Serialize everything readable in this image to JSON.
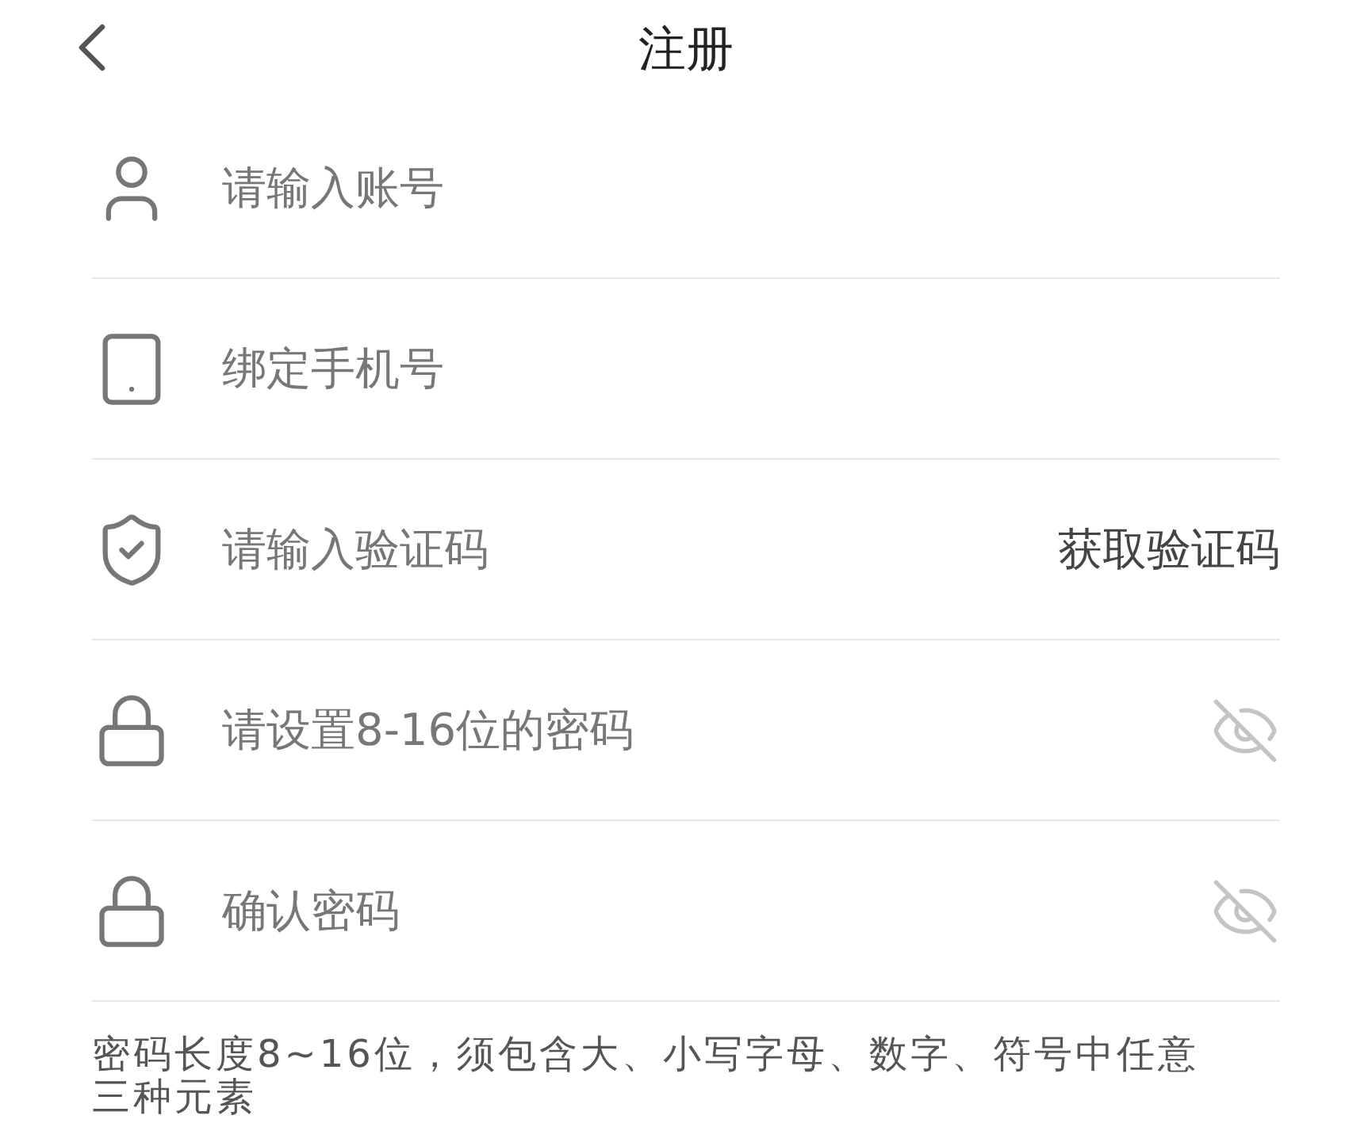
{
  "header": {
    "title": "注册"
  },
  "fields": [
    {
      "kind": "user",
      "placeholder": "请输入账号"
    },
    {
      "kind": "phone",
      "placeholder": "绑定手机号"
    },
    {
      "kind": "shield",
      "placeholder": "请输入验证码",
      "action": {
        "kind": "code",
        "label": "获取验证码"
      }
    },
    {
      "kind": "lock",
      "placeholder": "请设置8-16位的密码",
      "action": {
        "kind": "eye",
        "visible": false
      }
    },
    {
      "kind": "lock",
      "placeholder": "确认密码",
      "action": {
        "kind": "eye",
        "visible": false
      }
    }
  ],
  "hint": "密码长度8~16位，须包含大、小写字母、数字、符号中任意三种元素"
}
